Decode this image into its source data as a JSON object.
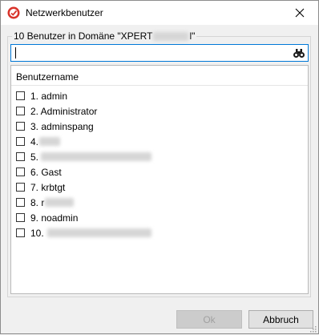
{
  "window": {
    "title": "Netzwerkbenutzer",
    "icon": "app-logo-icon",
    "close_icon": "close-icon"
  },
  "group": {
    "caption_prefix": "10 Benutzer in Domäne \"XPERT",
    "caption_suffix": "l\""
  },
  "search": {
    "value": "",
    "icon": "binoculars-icon"
  },
  "list": {
    "column_header": "Benutzername",
    "items": [
      {
        "label": "1. admin",
        "checked": false,
        "blurred": false
      },
      {
        "label": "2. Administrator",
        "checked": false,
        "blurred": false
      },
      {
        "label": "3. adminspang",
        "checked": false,
        "blurred": false
      },
      {
        "label": "4.",
        "checked": false,
        "blurred": true
      },
      {
        "label": "5.",
        "checked": false,
        "blurred": true
      },
      {
        "label": "6. Gast",
        "checked": false,
        "blurred": false
      },
      {
        "label": "7. krbtgt",
        "checked": false,
        "blurred": false
      },
      {
        "label": "8. r",
        "checked": false,
        "blurred": true
      },
      {
        "label": "9. noadmin",
        "checked": false,
        "blurred": false
      },
      {
        "label": "10.",
        "checked": false,
        "blurred": true
      }
    ]
  },
  "buttons": {
    "ok_label": "Ok",
    "cancel_label": "Abbruch"
  },
  "colors": {
    "accent": "#0078d7",
    "icon_red": "#d9342b"
  }
}
